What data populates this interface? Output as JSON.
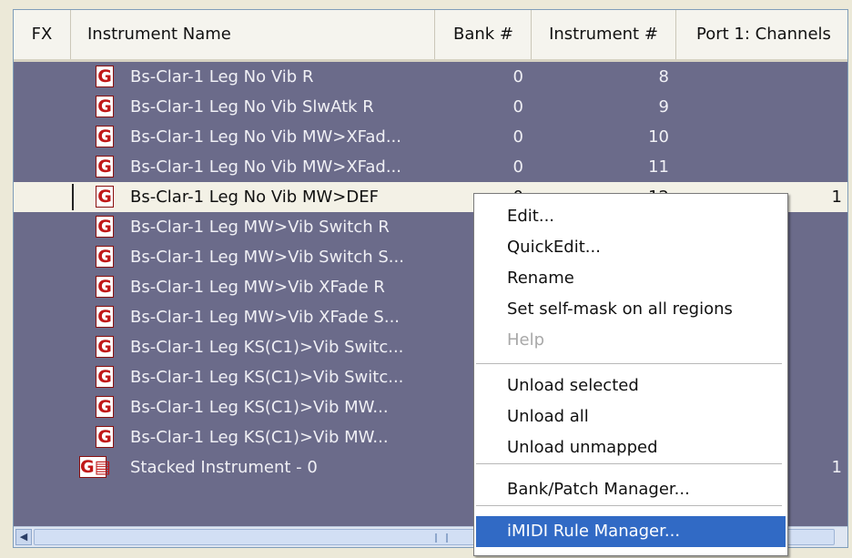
{
  "columns": {
    "fx": "FX",
    "name": "Instrument Name",
    "bank": "Bank #",
    "instrument": "Instrument #",
    "channels": "Port 1: Channels"
  },
  "instruments": [
    {
      "icon": "G",
      "name": "Bs-Clar-1 Leg No Vib R",
      "bank": "0",
      "num": "8",
      "channels": ""
    },
    {
      "icon": "G",
      "name": "Bs-Clar-1 Leg No Vib SlwAtk R",
      "bank": "0",
      "num": "9",
      "channels": ""
    },
    {
      "icon": "G",
      "name": "Bs-Clar-1 Leg No Vib MW>XFad...",
      "bank": "0",
      "num": "10",
      "channels": ""
    },
    {
      "icon": "G",
      "name": "Bs-Clar-1 Leg No Vib MW>XFad...",
      "bank": "0",
      "num": "11",
      "channels": ""
    },
    {
      "icon": "G",
      "name": "Bs-Clar-1 Leg No Vib MW>DEF",
      "bank": "0",
      "num": "12",
      "channels": "1"
    },
    {
      "icon": "G",
      "name": "Bs-Clar-1 Leg MW>Vib Switch R",
      "bank": "",
      "num": "",
      "channels": ""
    },
    {
      "icon": "G",
      "name": "Bs-Clar-1 Leg MW>Vib Switch S...",
      "bank": "",
      "num": "",
      "channels": ""
    },
    {
      "icon": "G",
      "name": "Bs-Clar-1 Leg MW>Vib XFade R",
      "bank": "",
      "num": "",
      "channels": ""
    },
    {
      "icon": "G",
      "name": "Bs-Clar-1 Leg MW>Vib XFade S...",
      "bank": "",
      "num": "",
      "channels": ""
    },
    {
      "icon": "G",
      "name": "Bs-Clar-1 Leg KS(C1)>Vib Switc...",
      "bank": "",
      "num": "",
      "channels": ""
    },
    {
      "icon": "G",
      "name": "Bs-Clar-1 Leg KS(C1)>Vib Switc...",
      "bank": "",
      "num": "",
      "channels": ""
    },
    {
      "icon": "G",
      "name": "Bs-Clar-1 Leg KS(C1)>Vib MW...",
      "bank": "",
      "num": "",
      "channels": ""
    },
    {
      "icon": "G",
      "name": "Bs-Clar-1 Leg KS(C1)>Vib MW...",
      "bank": "",
      "num": "",
      "channels": ""
    },
    {
      "icon": "G▤",
      "name": "Stacked Instrument - 0",
      "bank": "",
      "num": "",
      "channels": "1"
    }
  ],
  "selected_row": 4,
  "context_menu": {
    "items": [
      {
        "label": "Edit...",
        "enabled": true
      },
      {
        "label": "QuickEdit...",
        "enabled": true
      },
      {
        "label": "Rename",
        "enabled": true
      },
      {
        "label": "Set self-mask on all regions",
        "enabled": true
      },
      {
        "label": "Help",
        "enabled": false
      },
      {
        "label": "Unload selected",
        "enabled": true
      },
      {
        "label": "Unload all",
        "enabled": true
      },
      {
        "label": "Unload unmapped",
        "enabled": true
      },
      {
        "label": "Bank/Patch Manager...",
        "enabled": true
      },
      {
        "label": "iMIDI Rule Manager...",
        "enabled": true,
        "highlighted": true
      }
    ]
  },
  "colors": {
    "list_background": "#6b6b8a",
    "selection_background": "#f3f1e6",
    "menu_highlight": "#316ac5",
    "instrument_icon": "#c01818"
  },
  "icons": {
    "instrument": "gig-instrument-icon",
    "stacked": "stacked-instrument-icon",
    "scroll_left": "scroll-left-arrow-icon"
  },
  "scroll_left_glyph": "◀"
}
